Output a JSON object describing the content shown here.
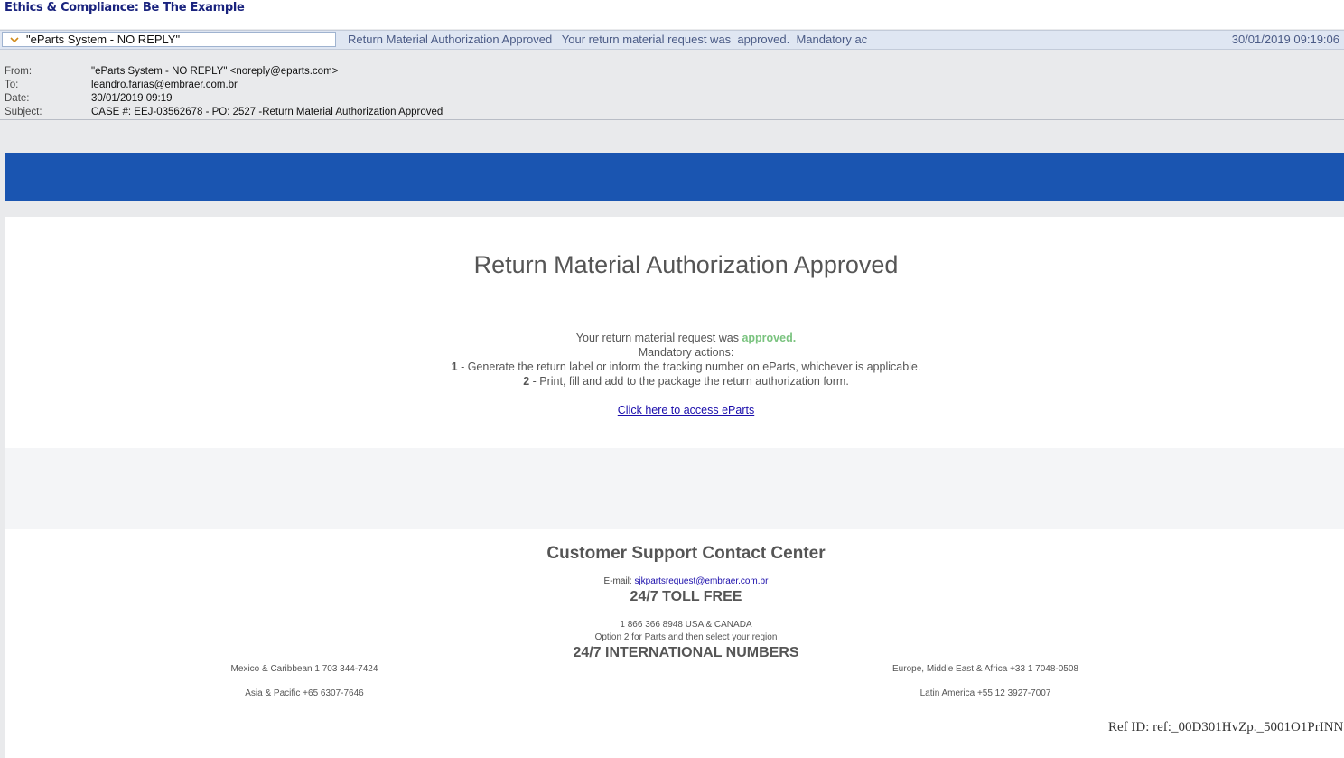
{
  "window": {
    "title": "Ethics & Compliance: Be The Example"
  },
  "message_row": {
    "sender": "\"eParts System - NO REPLY\"",
    "preview": "Return Material Authorization Approved   Your return material request was  approved.  Mandatory ac",
    "datetime": "30/01/2019 09:19:06"
  },
  "headers": {
    "from_label": "From:",
    "from_value": "\"eParts System - NO REPLY\" <noreply@eparts.com>",
    "to_label": "To:",
    "to_value": "leandro.farias@embraer.com.br",
    "date_label": "Date:",
    "date_value": "30/01/2019 09:19",
    "subject_label": "Subject:",
    "subject_value": "CASE #: EEJ-03562678 - PO: 2527 -Return Material Authorization Approved"
  },
  "email": {
    "title": "Return Material Authorization Approved",
    "line1_prefix": "Your return material request was ",
    "line1_status": "approved.",
    "line2": "Mandatory actions:",
    "action1_num": "1",
    "action1_text": " - Generate the return label or inform the tracking number on eParts, whichever is applicable.",
    "action2_num": "2",
    "action2_text": " - Print, fill and add to the package the return authorization form.",
    "link_text": "Click here to access eParts"
  },
  "footer": {
    "title": "Customer Support Contact Center",
    "email_label": "E-mail: ",
    "email_value": "sjkpartsrequest@embraer.com.br",
    "toll_free_heading": "24/7 TOLL FREE",
    "toll_free_number": "1 866 366 8948 USA & CANADA",
    "option_text": "Option 2 for Parts and then select your region",
    "intl_heading": "24/7 INTERNATIONAL NUMBERS",
    "mexico": "Mexico & Caribbean 1 703 344-7424",
    "asia": "Asia & Pacific +65 6307-7646",
    "europe": "Europe, Middle East & Africa +33 1 7048-0508",
    "latam": "Latin America +55 12 3927-7007",
    "ref": "Ref ID: ref:_00D301HvZp._5001O1PrINN"
  },
  "colors": {
    "banner": "#1a55b1",
    "approved": "#7ac37f",
    "link": "#1a0dab"
  }
}
